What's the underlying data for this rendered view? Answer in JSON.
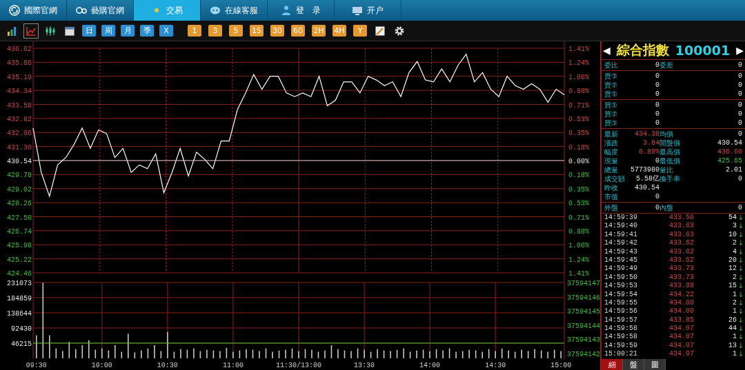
{
  "nav": [
    {
      "label": "國際官網",
      "selected": false
    },
    {
      "label": "藝購官網",
      "selected": false
    },
    {
      "label": "交易",
      "selected": true
    },
    {
      "label": "在線客服",
      "selected": false
    },
    {
      "label": "登　录",
      "selected": false
    },
    {
      "label": "开户",
      "selected": false
    }
  ],
  "toolbar": [
    {
      "kind": "icon",
      "selected": false
    },
    {
      "kind": "icon",
      "selected": true
    },
    {
      "kind": "icon",
      "selected": false
    },
    {
      "kind": "icon",
      "selected": false
    },
    {
      "kind": "period",
      "label": "日"
    },
    {
      "kind": "period",
      "label": "周"
    },
    {
      "kind": "period",
      "label": "月"
    },
    {
      "kind": "period",
      "label": "季"
    },
    {
      "kind": "period",
      "label": "X"
    },
    {
      "kind": "minute",
      "label": "1"
    },
    {
      "kind": "minute",
      "label": "3"
    },
    {
      "kind": "minute",
      "label": "5"
    },
    {
      "kind": "minute",
      "label": "15"
    },
    {
      "kind": "minute",
      "label": "30"
    },
    {
      "kind": "minute",
      "label": "60"
    },
    {
      "kind": "minute",
      "label": "2H"
    },
    {
      "kind": "minute",
      "label": "4H"
    },
    {
      "kind": "minute",
      "label": "Y"
    },
    {
      "kind": "icon",
      "selected": false
    },
    {
      "kind": "icon",
      "selected": false
    }
  ],
  "price_chart": {
    "percent_axis": [
      "1.41%",
      "1.24%",
      "1.06%",
      "0.88%",
      "0.71%",
      "0.53%",
      "0.35%",
      "0.18%",
      "0.00%",
      "0.18%",
      "0.35%",
      "0.53%",
      "0.71%",
      "0.88%",
      "1.06%",
      "1.24%",
      "1.41%"
    ],
    "chart_data": {
      "type": "line",
      "grid": true,
      "ylim": [
        424.46,
        436.62
      ],
      "yticks": [
        {
          "value": 436.62,
          "label": "436.62"
        },
        {
          "value": 435.86,
          "label": "435.86"
        },
        {
          "value": 435.1,
          "label": "435.10"
        },
        {
          "value": 434.34,
          "label": "434.34"
        },
        {
          "value": 433.58,
          "label": "433.58"
        },
        {
          "value": 432.82,
          "label": "432.82"
        },
        {
          "value": 432.06,
          "label": "432.06"
        },
        {
          "value": 431.3,
          "label": "431.30"
        },
        {
          "value": 430.54,
          "label": "430.54"
        },
        {
          "value": 429.78,
          "label": "429.78"
        },
        {
          "value": 429.02,
          "label": "429.02"
        },
        {
          "value": 428.26,
          "label": "428.26"
        },
        {
          "value": 427.5,
          "label": "427.50"
        },
        {
          "value": 426.74,
          "label": "426.74"
        },
        {
          "value": 425.98,
          "label": "425.98"
        },
        {
          "value": 425.22,
          "label": "425.22"
        },
        {
          "value": 424.46,
          "label": "424.46"
        }
      ],
      "ref_lines": [
        {
          "axis": "y",
          "value": 430.54,
          "color": "#c0c0c0"
        }
      ],
      "categories": [
        null,
        null,
        null,
        null,
        null,
        null,
        null,
        null,
        null,
        null,
        null,
        null,
        null,
        null,
        null,
        null,
        null,
        null,
        null,
        null,
        null,
        null,
        null,
        null,
        null,
        null,
        null,
        null,
        null,
        null,
        null,
        null,
        null,
        null,
        null,
        null,
        null,
        null,
        null,
        null,
        null,
        null,
        null,
        null,
        null,
        null,
        null,
        null,
        null,
        null,
        null,
        null,
        null,
        null,
        null,
        null,
        null,
        null,
        null,
        null,
        null,
        null,
        null,
        null,
        null,
        null
      ],
      "series": [
        {
          "color": "#ffffff",
          "values": [
            432.3,
            429.9,
            428.6,
            430.3,
            430.7,
            431.4,
            432.3,
            431.2,
            432.2,
            432.0,
            430.7,
            431.2,
            429.9,
            430.3,
            430.1,
            430.9,
            428.8,
            429.9,
            431.2,
            429.7,
            431.0,
            430.6,
            430.1,
            431.6,
            431.6,
            433.3,
            434.2,
            435.2,
            434.4,
            435.1,
            435.1,
            434.2,
            434.0,
            434.2,
            434.0,
            435.1,
            433.5,
            433.8,
            434.8,
            434.8,
            434.2,
            435.1,
            434.9,
            434.6,
            434.8,
            434.0,
            435.3,
            435.9,
            434.9,
            434.8,
            435.5,
            434.8,
            435.7,
            436.3,
            434.8,
            435.3,
            434.4,
            434.0,
            435.1,
            434.6,
            434.4,
            434.7,
            434.4,
            433.7,
            434.4,
            434.1
          ]
        }
      ]
    }
  },
  "volume_chart": {
    "right_axis": [
      "37594147",
      "37594146",
      "37594145",
      "37594144",
      "37594143",
      "37594142"
    ],
    "chart_data": {
      "type": "bar",
      "grid": true,
      "ylim": [
        0,
        231073
      ],
      "yticks": [
        {
          "value": 231073,
          "label": "231073"
        },
        {
          "value": 184859,
          "label": "184859"
        },
        {
          "value": 138644,
          "label": "138644"
        },
        {
          "value": 92430,
          "label": "92430"
        },
        {
          "value": 46215,
          "label": "46215"
        }
      ],
      "ref_lines": [
        {
          "axis": "y",
          "value": 46215,
          "color": "#3fbf3f"
        }
      ],
      "categories": [
        "09:30",
        null,
        null,
        null,
        null,
        null,
        null,
        null,
        null,
        null,
        "10:00",
        null,
        null,
        null,
        null,
        null,
        null,
        null,
        null,
        null,
        "10:30",
        null,
        null,
        null,
        null,
        null,
        null,
        null,
        null,
        null,
        "11:00",
        null,
        null,
        null,
        null,
        null,
        null,
        null,
        null,
        null,
        "11:30/13:00",
        null,
        null,
        null,
        null,
        null,
        null,
        null,
        null,
        null,
        "13:30",
        null,
        null,
        null,
        null,
        null,
        null,
        null,
        null,
        null,
        "14:00",
        null,
        null,
        null,
        null,
        null,
        null,
        null,
        null,
        null,
        "14:30",
        null,
        null,
        null,
        null,
        null,
        null,
        null,
        null,
        null,
        "15:00"
      ],
      "series": [
        {
          "color": "#c8c8c8",
          "values": [
            70000,
            230000,
            70000,
            30000,
            22000,
            50000,
            28000,
            40000,
            55000,
            26000,
            30000,
            24000,
            40000,
            20000,
            75000,
            18000,
            24000,
            30000,
            40000,
            22000,
            80000,
            20000,
            28000,
            26000,
            30000,
            22000,
            26000,
            24000,
            22000,
            32000,
            20000,
            24000,
            28000,
            26000,
            22000,
            30000,
            20000,
            24000,
            26000,
            30000,
            22000,
            28000,
            26000,
            20000,
            24000,
            40000,
            28000,
            24000,
            22000,
            30000,
            26000,
            20000,
            28000,
            24000,
            22000,
            26000,
            30000,
            20000,
            24000,
            26000,
            22000,
            28000,
            24000,
            30000,
            20000,
            22000,
            26000,
            24000,
            20000,
            28000,
            22000,
            30000,
            24000,
            20000,
            26000,
            22000,
            28000,
            24000,
            20000,
            26000,
            22000
          ]
        }
      ]
    }
  },
  "quote": {
    "name": "綜合指數",
    "code": "100001",
    "prev": "◀",
    "next": "▶",
    "groups": [
      [
        {
          "left": {
            "label": "委比",
            "value": "0",
            "rise": false,
            "fall": false
          },
          "right": {
            "label": "委差",
            "value": "0",
            "rise": false,
            "fall": false
          }
        }
      ],
      [
        {
          "left": {
            "label": "賣③",
            "value": "0",
            "rise": false,
            "fall": false
          },
          "right": {
            "value": "0",
            "rise": false,
            "fall": false
          }
        },
        {
          "left": {
            "label": "賣②",
            "value": "0",
            "rise": false,
            "fall": false
          },
          "right": {
            "value": "0",
            "rise": false,
            "fall": false
          }
        },
        {
          "left": {
            "label": "賣①",
            "value": "0",
            "rise": false,
            "fall": false
          },
          "right": {
            "value": "0",
            "rise": false,
            "fall": false
          }
        }
      ],
      [
        {
          "left": {
            "label": "買①",
            "value": "0",
            "rise": false,
            "fall": false
          },
          "right": {
            "value": "0",
            "rise": false,
            "fall": false
          }
        },
        {
          "left": {
            "label": "買②",
            "value": "0",
            "rise": false,
            "fall": false
          },
          "right": {
            "value": "0",
            "rise": false,
            "fall": false
          }
        },
        {
          "left": {
            "label": "買③",
            "value": "0",
            "rise": false,
            "fall": false
          },
          "right": {
            "value": "0",
            "rise": false,
            "fall": false
          }
        }
      ],
      [
        {
          "left": {
            "label": "最新",
            "value": "434.38",
            "rise": true,
            "fall": false
          },
          "right": {
            "label": "均價",
            "value": "0",
            "rise": false,
            "fall": false
          }
        },
        {
          "left": {
            "label": "漲跌",
            "value": "3.84",
            "rise": true,
            "fall": false
          },
          "right": {
            "label": "開盤價",
            "value": "430.54",
            "rise": false,
            "fall": false
          }
        },
        {
          "left": {
            "label": "幅度",
            "value": "0.89%",
            "rise": true,
            "fall": false
          },
          "right": {
            "label": "最高價",
            "value": "436.60",
            "rise": true,
            "fall": false
          }
        },
        {
          "left": {
            "label": "現量",
            "value": "0",
            "rise": false,
            "fall": false
          },
          "right": {
            "label": "最低價",
            "value": "425.65",
            "rise": false,
            "fall": true
          }
        },
        {
          "left": {
            "label": "總量",
            "value": "5773980",
            "rise": false,
            "fall": false
          },
          "right": {
            "label": "量比",
            "value": "2.01",
            "rise": false,
            "fall": false
          }
        },
        {
          "left": {
            "label": "成交額",
            "value": "5.58亿",
            "rise": false,
            "fall": false
          },
          "right": {
            "label": "換手率",
            "value": "0",
            "rise": false,
            "fall": false
          }
        },
        {
          "left": {
            "label": "昨收",
            "value": "430.54",
            "rise": false,
            "fall": false
          }
        },
        {
          "left": {
            "label": "市值",
            "value": "0",
            "rise": false,
            "fall": false
          }
        }
      ],
      [
        {
          "left": {
            "label": "外盤",
            "value": "0",
            "rise": false,
            "fall": false
          },
          "right": {
            "label": "內盤",
            "value": "0",
            "rise": false,
            "fall": false
          }
        }
      ]
    ]
  },
  "ticks": [
    {
      "time": "14:59:39",
      "price": "433.56",
      "volume": "54",
      "arrow": "↓"
    },
    {
      "time": "14:59:40",
      "price": "433.63",
      "volume": "3",
      "arrow": "↓"
    },
    {
      "time": "14:59:41",
      "price": "433.63",
      "volume": "10",
      "arrow": "↓"
    },
    {
      "time": "14:59:42",
      "price": "433.62",
      "volume": "2",
      "arrow": "↓"
    },
    {
      "time": "14:59:43",
      "price": "433.62",
      "volume": "4",
      "arrow": "↓"
    },
    {
      "time": "14:59:45",
      "price": "433.62",
      "volume": "20",
      "arrow": "↓"
    },
    {
      "time": "14:59:49",
      "price": "433.73",
      "volume": "12",
      "arrow": "↓"
    },
    {
      "time": "14:59:50",
      "price": "433.73",
      "volume": "2",
      "arrow": "↓"
    },
    {
      "time": "14:59:53",
      "price": "433.88",
      "volume": "15",
      "arrow": "↓"
    },
    {
      "time": "14:59:54",
      "price": "434.22",
      "volume": "1",
      "arrow": "↓"
    },
    {
      "time": "14:59:55",
      "price": "434.00",
      "volume": "2",
      "arrow": "↓"
    },
    {
      "time": "14:59:56",
      "price": "434.00",
      "volume": "1",
      "arrow": "↓"
    },
    {
      "time": "14:59:57",
      "price": "433.85",
      "volume": "26",
      "arrow": "↓"
    },
    {
      "time": "14:59:58",
      "price": "434.07",
      "volume": "44",
      "arrow": "↓"
    },
    {
      "time": "14:59:58",
      "price": "434.07",
      "volume": "1",
      "arrow": "↓"
    },
    {
      "time": "14:59:59",
      "price": "434.07",
      "volume": "13",
      "arrow": "↓"
    },
    {
      "time": "15:00:21",
      "price": "434.07",
      "volume": "1",
      "arrow": "↓"
    }
  ],
  "panel_tabs": [
    {
      "label": "細",
      "selected": true
    },
    {
      "label": "盤",
      "selected": false
    },
    {
      "label": "圖",
      "selected": false
    }
  ]
}
